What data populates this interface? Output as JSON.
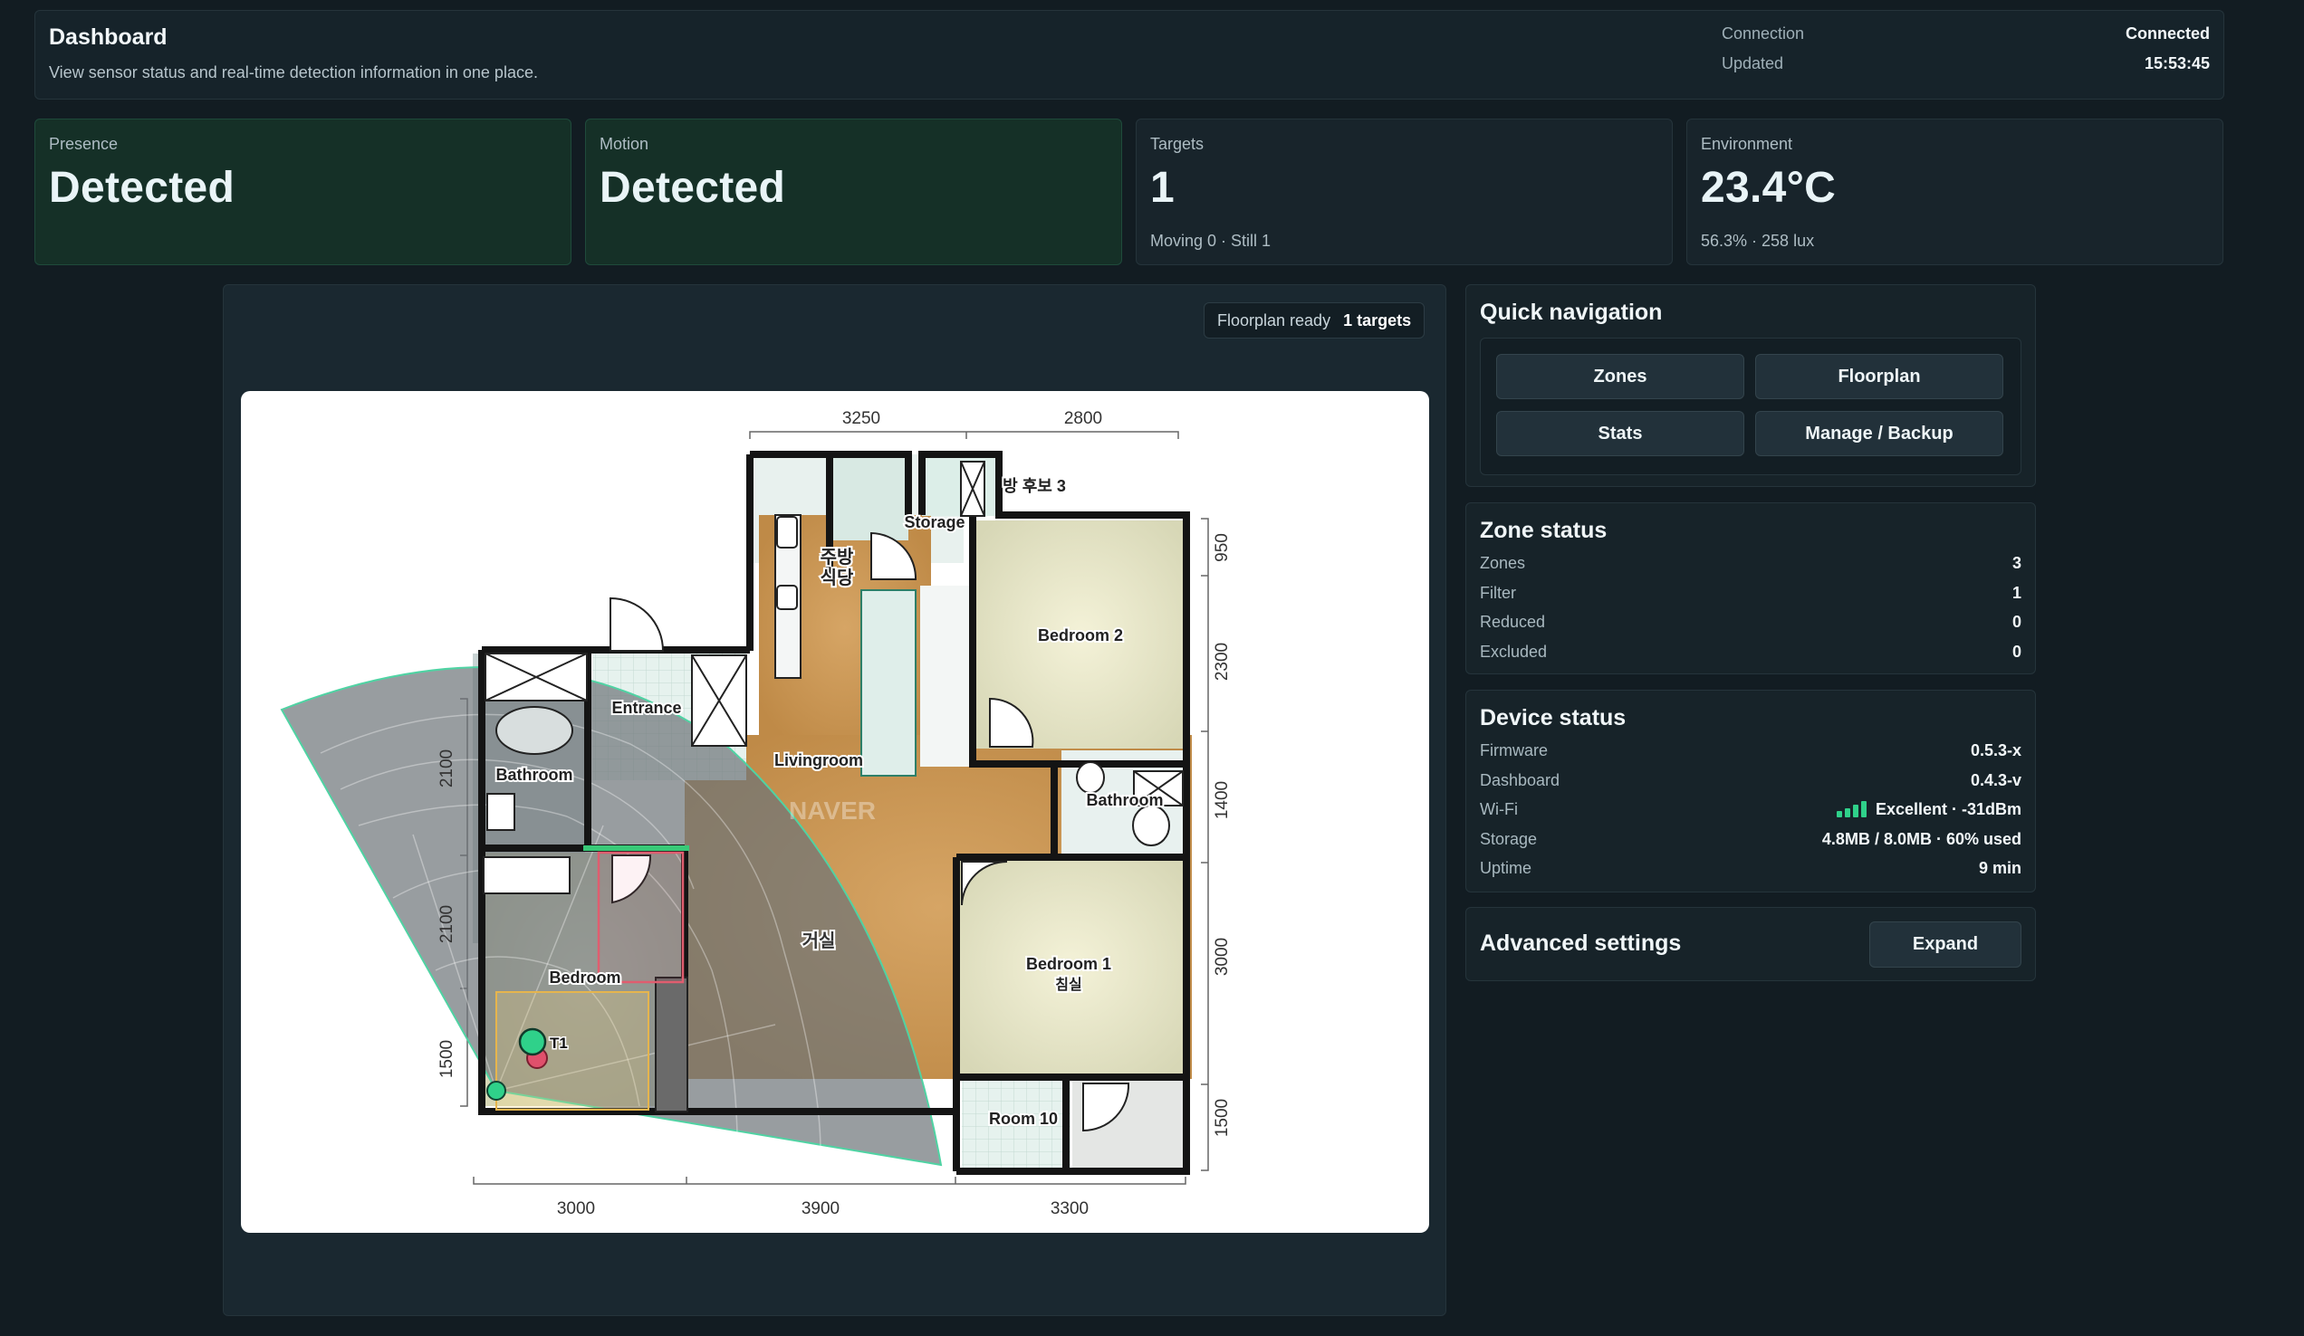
{
  "header": {
    "title": "Dashboard",
    "subtitle": "View sensor status and real-time detection information in one place.",
    "connection_label": "Connection",
    "connection_value": "Connected",
    "updated_label": "Updated",
    "updated_value": "15:53:45"
  },
  "cards": {
    "presence": {
      "label": "Presence",
      "value": "Detected"
    },
    "motion": {
      "label": "Motion",
      "value": "Detected"
    },
    "targets": {
      "label": "Targets",
      "value": "1",
      "sub": "Moving 0 · Still 1"
    },
    "environment": {
      "label": "Environment",
      "value": "23.4°C",
      "sub": "56.3% · 258 lux"
    }
  },
  "floorplan": {
    "status": "Floorplan ready",
    "targets_badge": "1 targets",
    "dims_top": [
      "3250",
      "2800"
    ],
    "dims_bottom": [
      "3000",
      "3900",
      "3300"
    ],
    "dims_left": [
      "2100",
      "2100",
      "1500"
    ],
    "dims_right": [
      "950",
      "2300",
      "1400",
      "3000",
      "1500"
    ],
    "rooms": {
      "storage": "Storage",
      "room3": "방 후보 3",
      "kitchen_line1": "주방",
      "kitchen_line2": "식당",
      "bedroom2": "Bedroom 2",
      "entrance": "Entrance",
      "bathroom_left": "Bathroom",
      "livingroom": "Livingroom",
      "bathroom_right": "Bathroom",
      "living_korean": "거실",
      "bedroom": "Bedroom",
      "bedroom1_line1": "Bedroom 1",
      "bedroom1_line2": "침실",
      "room10": "Room 10"
    },
    "watermark": "NAVER",
    "target_label": "T1"
  },
  "quick_nav": {
    "title": "Quick navigation",
    "buttons": [
      "Zones",
      "Floorplan",
      "Stats",
      "Manage / Backup"
    ]
  },
  "zone_status": {
    "title": "Zone status",
    "rows": [
      {
        "label": "Zones",
        "value": "3"
      },
      {
        "label": "Filter",
        "value": "1"
      },
      {
        "label": "Reduced",
        "value": "0"
      },
      {
        "label": "Excluded",
        "value": "0"
      }
    ]
  },
  "device_status": {
    "title": "Device status",
    "rows": [
      {
        "label": "Firmware",
        "value": "0.5.3-x"
      },
      {
        "label": "Dashboard",
        "value": "0.4.3-v"
      },
      {
        "label": "Wi-Fi",
        "value": "Excellent · -31dBm"
      },
      {
        "label": "Storage",
        "value": "4.8MB / 8.0MB · 60% used"
      },
      {
        "label": "Uptime",
        "value": "9 min"
      }
    ]
  },
  "advanced": {
    "title": "Advanced settings",
    "button": "Expand"
  },
  "colors": {
    "accent": "#2fd18a",
    "target": "#e0506c"
  }
}
